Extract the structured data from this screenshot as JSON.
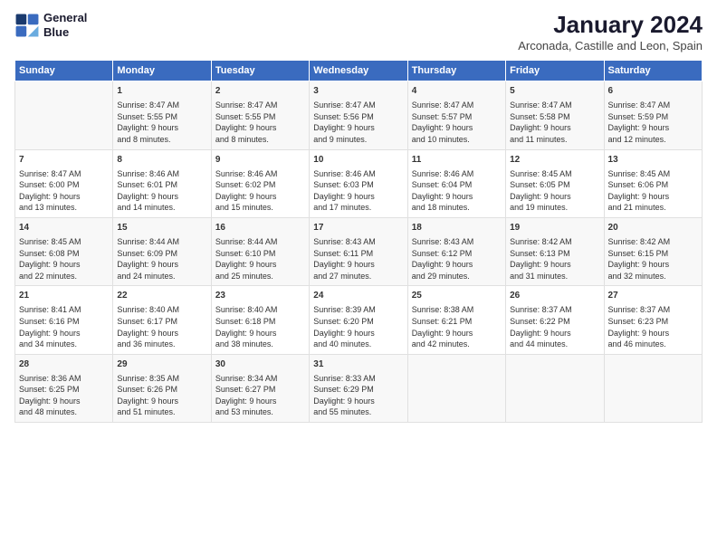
{
  "logo": {
    "line1": "General",
    "line2": "Blue"
  },
  "title": "January 2024",
  "subtitle": "Arconada, Castille and Leon, Spain",
  "days_header": [
    "Sunday",
    "Monday",
    "Tuesday",
    "Wednesday",
    "Thursday",
    "Friday",
    "Saturday"
  ],
  "weeks": [
    [
      {
        "day": "",
        "content": ""
      },
      {
        "day": "1",
        "content": "Sunrise: 8:47 AM\nSunset: 5:55 PM\nDaylight: 9 hours\nand 8 minutes."
      },
      {
        "day": "2",
        "content": "Sunrise: 8:47 AM\nSunset: 5:55 PM\nDaylight: 9 hours\nand 8 minutes."
      },
      {
        "day": "3",
        "content": "Sunrise: 8:47 AM\nSunset: 5:56 PM\nDaylight: 9 hours\nand 9 minutes."
      },
      {
        "day": "4",
        "content": "Sunrise: 8:47 AM\nSunset: 5:57 PM\nDaylight: 9 hours\nand 10 minutes."
      },
      {
        "day": "5",
        "content": "Sunrise: 8:47 AM\nSunset: 5:58 PM\nDaylight: 9 hours\nand 11 minutes."
      },
      {
        "day": "6",
        "content": "Sunrise: 8:47 AM\nSunset: 5:59 PM\nDaylight: 9 hours\nand 12 minutes."
      }
    ],
    [
      {
        "day": "7",
        "content": "Sunrise: 8:47 AM\nSunset: 6:00 PM\nDaylight: 9 hours\nand 13 minutes."
      },
      {
        "day": "8",
        "content": "Sunrise: 8:46 AM\nSunset: 6:01 PM\nDaylight: 9 hours\nand 14 minutes."
      },
      {
        "day": "9",
        "content": "Sunrise: 8:46 AM\nSunset: 6:02 PM\nDaylight: 9 hours\nand 15 minutes."
      },
      {
        "day": "10",
        "content": "Sunrise: 8:46 AM\nSunset: 6:03 PM\nDaylight: 9 hours\nand 17 minutes."
      },
      {
        "day": "11",
        "content": "Sunrise: 8:46 AM\nSunset: 6:04 PM\nDaylight: 9 hours\nand 18 minutes."
      },
      {
        "day": "12",
        "content": "Sunrise: 8:45 AM\nSunset: 6:05 PM\nDaylight: 9 hours\nand 19 minutes."
      },
      {
        "day": "13",
        "content": "Sunrise: 8:45 AM\nSunset: 6:06 PM\nDaylight: 9 hours\nand 21 minutes."
      }
    ],
    [
      {
        "day": "14",
        "content": "Sunrise: 8:45 AM\nSunset: 6:08 PM\nDaylight: 9 hours\nand 22 minutes."
      },
      {
        "day": "15",
        "content": "Sunrise: 8:44 AM\nSunset: 6:09 PM\nDaylight: 9 hours\nand 24 minutes."
      },
      {
        "day": "16",
        "content": "Sunrise: 8:44 AM\nSunset: 6:10 PM\nDaylight: 9 hours\nand 25 minutes."
      },
      {
        "day": "17",
        "content": "Sunrise: 8:43 AM\nSunset: 6:11 PM\nDaylight: 9 hours\nand 27 minutes."
      },
      {
        "day": "18",
        "content": "Sunrise: 8:43 AM\nSunset: 6:12 PM\nDaylight: 9 hours\nand 29 minutes."
      },
      {
        "day": "19",
        "content": "Sunrise: 8:42 AM\nSunset: 6:13 PM\nDaylight: 9 hours\nand 31 minutes."
      },
      {
        "day": "20",
        "content": "Sunrise: 8:42 AM\nSunset: 6:15 PM\nDaylight: 9 hours\nand 32 minutes."
      }
    ],
    [
      {
        "day": "21",
        "content": "Sunrise: 8:41 AM\nSunset: 6:16 PM\nDaylight: 9 hours\nand 34 minutes."
      },
      {
        "day": "22",
        "content": "Sunrise: 8:40 AM\nSunset: 6:17 PM\nDaylight: 9 hours\nand 36 minutes."
      },
      {
        "day": "23",
        "content": "Sunrise: 8:40 AM\nSunset: 6:18 PM\nDaylight: 9 hours\nand 38 minutes."
      },
      {
        "day": "24",
        "content": "Sunrise: 8:39 AM\nSunset: 6:20 PM\nDaylight: 9 hours\nand 40 minutes."
      },
      {
        "day": "25",
        "content": "Sunrise: 8:38 AM\nSunset: 6:21 PM\nDaylight: 9 hours\nand 42 minutes."
      },
      {
        "day": "26",
        "content": "Sunrise: 8:37 AM\nSunset: 6:22 PM\nDaylight: 9 hours\nand 44 minutes."
      },
      {
        "day": "27",
        "content": "Sunrise: 8:37 AM\nSunset: 6:23 PM\nDaylight: 9 hours\nand 46 minutes."
      }
    ],
    [
      {
        "day": "28",
        "content": "Sunrise: 8:36 AM\nSunset: 6:25 PM\nDaylight: 9 hours\nand 48 minutes."
      },
      {
        "day": "29",
        "content": "Sunrise: 8:35 AM\nSunset: 6:26 PM\nDaylight: 9 hours\nand 51 minutes."
      },
      {
        "day": "30",
        "content": "Sunrise: 8:34 AM\nSunset: 6:27 PM\nDaylight: 9 hours\nand 53 minutes."
      },
      {
        "day": "31",
        "content": "Sunrise: 8:33 AM\nSunset: 6:29 PM\nDaylight: 9 hours\nand 55 minutes."
      },
      {
        "day": "",
        "content": ""
      },
      {
        "day": "",
        "content": ""
      },
      {
        "day": "",
        "content": ""
      }
    ]
  ]
}
